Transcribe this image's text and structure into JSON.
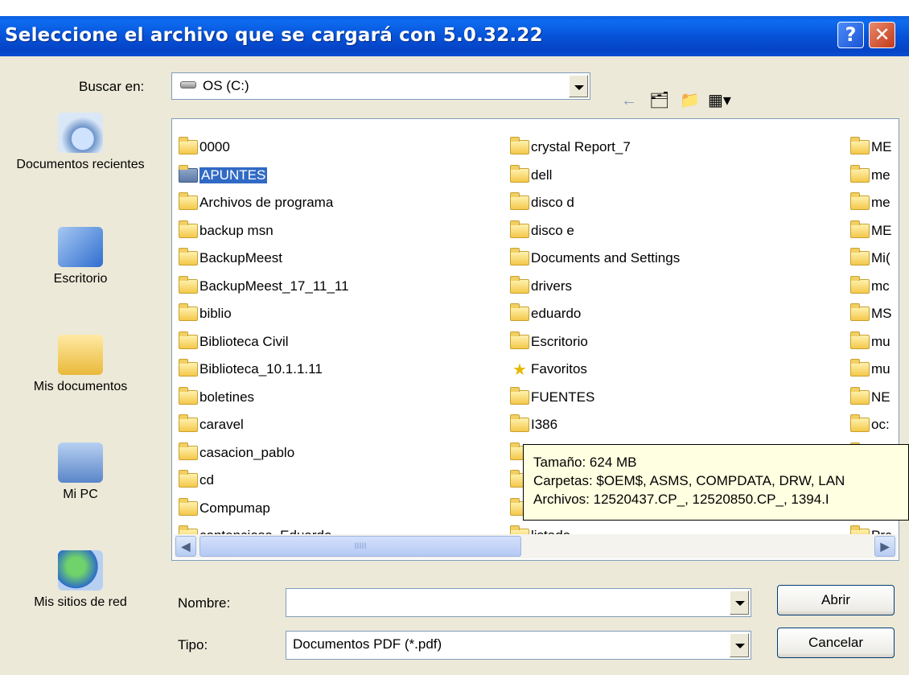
{
  "window": {
    "title": "Seleccione el archivo que se cargará con 5.0.32.22",
    "help_label": "?",
    "close_label": "✕"
  },
  "lookin": {
    "label": "Buscar en:",
    "value": "OS (C:)"
  },
  "toolbar": {
    "back_icon": "back-arrow-icon",
    "up_icon": "up-folder-icon",
    "new_icon": "new-folder-icon",
    "view_icon": "view-menu-icon"
  },
  "places": [
    {
      "label": "Documentos recientes",
      "icon": "recent-documents-icon"
    },
    {
      "label": "Escritorio",
      "icon": "desktop-icon"
    },
    {
      "label": "Mis documentos",
      "icon": "my-documents-icon"
    },
    {
      "label": "Mi PC",
      "icon": "my-computer-icon"
    },
    {
      "label": "Mis sitios de red",
      "icon": "network-places-icon"
    }
  ],
  "files": {
    "col1": [
      "0000",
      "APUNTES",
      "Archivos de programa",
      "backup msn",
      "BackupMeest",
      "BackupMeest_17_11_11",
      "biblio",
      "Biblioteca Civil",
      "Biblioteca_10.1.1.11",
      "boletines",
      "caravel",
      "casacion_pablo",
      "cd",
      "Compumap",
      "contencioso_Eduardo"
    ],
    "col2": [
      "crystal Report_7",
      "dell",
      "disco d",
      "disco e",
      "Documents and Settings",
      "drivers",
      "eduardo",
      "Escritorio",
      "Favoritos",
      "FUENTES",
      "I386",
      "",
      "",
      "",
      "listado"
    ],
    "col3": [
      "ME",
      "me",
      "me",
      "ME",
      "Mi(",
      "mc",
      "MS",
      "mu",
      "mu",
      "NE",
      "oc:",
      "",
      "",
      "",
      "Prc"
    ],
    "selected": "APUNTES"
  },
  "tooltip": {
    "size": "Tamaño: 624 MB",
    "folders": "Carpetas: $OEM$, ASMS, COMPDATA, DRW, LAN",
    "files": "Archivos: 12520437.CP_, 12520850.CP_, 1394.I"
  },
  "scrollbar": {
    "thumb_grip": "IIIII"
  },
  "filename": {
    "label": "Nombre:",
    "value": ""
  },
  "filetype": {
    "label": "Tipo:",
    "value": "Documentos PDF (*.pdf)"
  },
  "buttons": {
    "open": "Abrir",
    "cancel": "Cancelar"
  }
}
